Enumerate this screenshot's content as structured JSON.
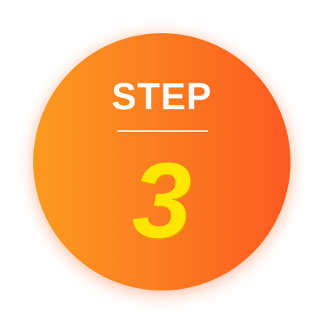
{
  "badge": {
    "label": "STEP",
    "number": "3",
    "colors": {
      "gradient_start": "#fb9a1e",
      "gradient_end": "#fb5a20",
      "label": "#ffffff",
      "number": "#ffe600"
    }
  }
}
